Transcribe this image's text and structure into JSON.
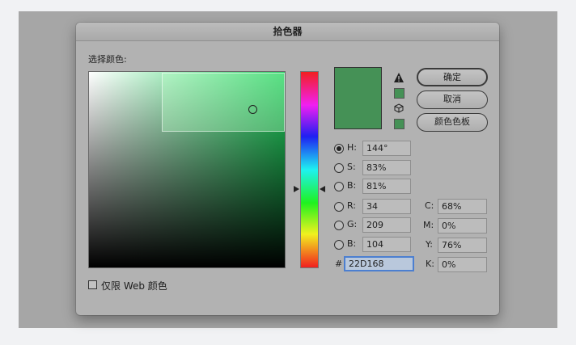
{
  "dialog": {
    "title": "拾色器",
    "select_color_label": "选择颜色:",
    "current_color": "#459156",
    "buttons": {
      "ok": "确定",
      "cancel": "取消",
      "swatches": "颜色色板"
    },
    "hsb": {
      "h_label": "H:",
      "h_value": "144°",
      "s_label": "S:",
      "s_value": "83%",
      "b_label": "B:",
      "b_value": "81%"
    },
    "rgb": {
      "r_label": "R:",
      "r_value": "34",
      "g_label": "G:",
      "g_value": "209",
      "b_label": "B:",
      "b_value": "104"
    },
    "cmyk": {
      "c_label": "C:",
      "c_value": "68%",
      "m_label": "M:",
      "m_value": "0%",
      "y_label": "Y:",
      "y_value": "76%",
      "k_label": "K:",
      "k_value": "0%"
    },
    "hex": {
      "label": "#",
      "value": "22D168"
    },
    "web_only_label": "仅限 Web 颜色",
    "icons": {
      "warning": "warning-triangle-icon",
      "web_safe": "cube-icon"
    }
  }
}
